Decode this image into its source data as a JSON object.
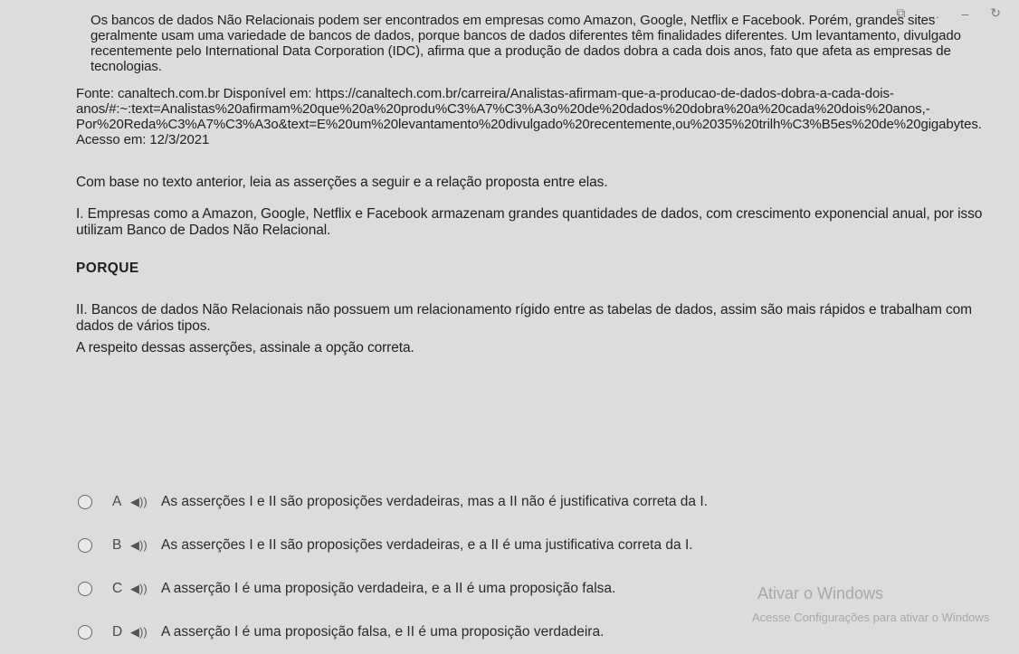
{
  "window": {
    "controls": [
      "⧉",
      "…",
      "–",
      "↻"
    ]
  },
  "text": {
    "intro": "Os bancos de dados Não Relacionais podem ser encontrados em empresas como Amazon, Google, Netflix e Facebook. Porém, grandes sites geralmente usam uma variedade de bancos de dados, porque bancos de dados diferentes têm finalidades diferentes. Um levantamento, divulgado recentemente pelo International Data Corporation (IDC), afirma que a produção de dados dobra a cada dois anos, fato que afeta as empresas de tecnologias.",
    "source_line1": "Fonte: canaltech.com.br Disponível em: https://canaltech.com.br/carreira/Analistas-afirmam-que-a-producao-de-dados-dobra-a-cada-dois-",
    "source_line2": "anos/#:~:text=Analistas%20afirmam%20que%20a%20produ%C3%A7%C3%A3o%20de%20dados%20dobra%20a%20cada%20dois%20anos,-",
    "source_line3": "Por%20Reda%C3%A7%C3%A3o&text=E%20um%20levantamento%20divulgado%20recentemente,ou%2035%20trilh%C3%B5es%20de%20gigabytes.",
    "source_line4": "Acesso em: 12/3/2021",
    "base": "Com base no texto anterior, leia as asserções a seguir e a relação proposta entre elas.",
    "assertion1": "I. Empresas como a Amazon, Google, Netflix e Facebook armazenam grandes quantidades de dados, com crescimento exponencial anual, por isso utilizam Banco de Dados Não Relacional.",
    "porque": "PORQUE",
    "assertion2": "II. Bancos de dados Não Relacionais não possuem um relacionamento rígido entre as tabelas de dados, assim são mais rápidos e trabalham com dados de vários tipos.",
    "question": "A respeito dessas asserções, assinale a opção correta."
  },
  "options": [
    {
      "letter": "A",
      "text": "As asserções I e II são proposições verdadeiras, mas a II não é justificativa correta da I."
    },
    {
      "letter": "B",
      "text": "As asserções I e II são proposições verdadeiras, e a II é uma justificativa correta da I."
    },
    {
      "letter": "C",
      "text": "A asserção I é uma proposição verdadeira, e a II é uma proposição falsa."
    },
    {
      "letter": "D",
      "text": "A asserção I é uma proposição falsa, e II é uma proposição verdadeira."
    }
  ],
  "icons": {
    "speaker": "◀))"
  },
  "watermark": {
    "title": "Ativar o Windows",
    "subtitle": "Acesse Configurações para ativar o Windows"
  }
}
